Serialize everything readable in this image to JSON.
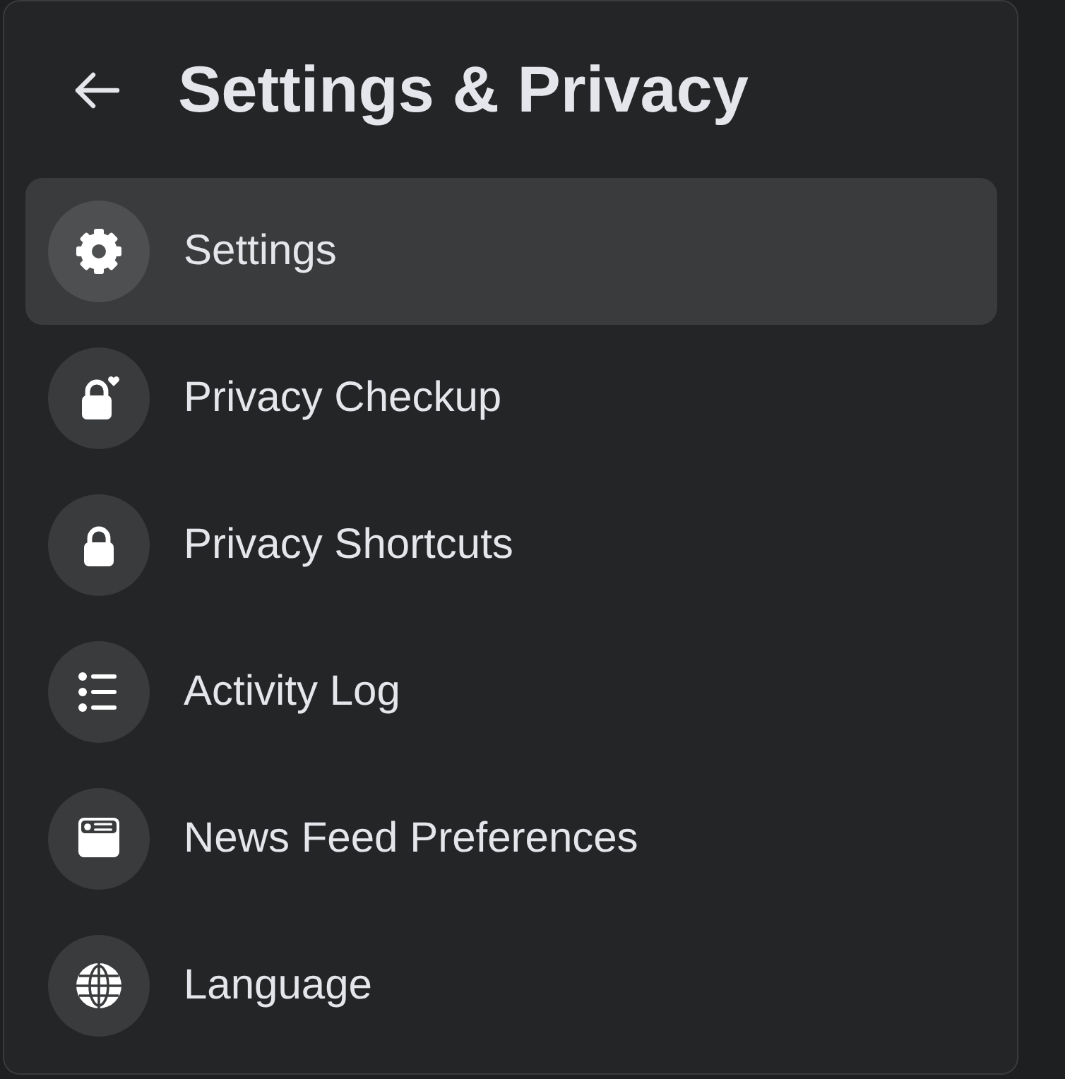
{
  "header": {
    "title": "Settings & Privacy"
  },
  "menu": {
    "items": [
      {
        "label": "Settings",
        "selected": true
      },
      {
        "label": "Privacy Checkup",
        "selected": false
      },
      {
        "label": "Privacy Shortcuts",
        "selected": false
      },
      {
        "label": "Activity Log",
        "selected": false
      },
      {
        "label": "News Feed Preferences",
        "selected": false
      },
      {
        "label": "Language",
        "selected": false
      }
    ]
  }
}
